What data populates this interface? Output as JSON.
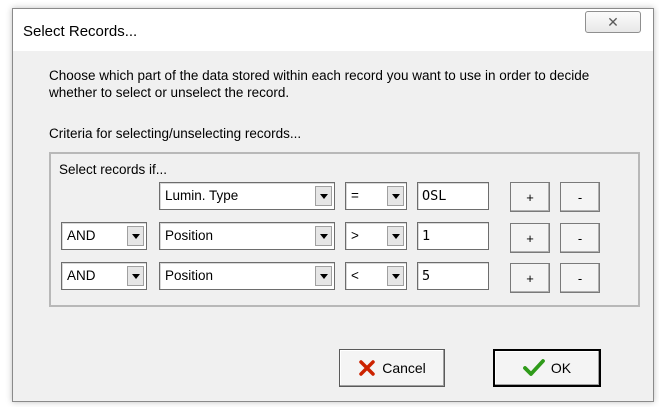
{
  "window": {
    "title": "Select Records...",
    "close_glyph": "✕"
  },
  "description": "Choose which part of the data stored within each record you want to use in order to decide whether to select or unselect the record.",
  "criteria_label": "Criteria for selecting/unselecting records...",
  "group_label": "Select records if...",
  "rows": [
    {
      "connector": "",
      "field": "Lumin. Type",
      "operator": "=",
      "value": "OSL"
    },
    {
      "connector": "AND",
      "field": "Position",
      "operator": ">",
      "value": "1"
    },
    {
      "connector": "AND",
      "field": "Position",
      "operator": "<",
      "value": "5"
    }
  ],
  "row_buttons": {
    "add": "+",
    "remove": "-"
  },
  "buttons": {
    "cancel": "Cancel",
    "ok": "OK"
  },
  "icons": {
    "cancel": "red-x-icon",
    "ok": "green-check-icon"
  },
  "colors": {
    "cancel_icon": "#cc2200",
    "ok_icon": "#2f9b1a"
  }
}
